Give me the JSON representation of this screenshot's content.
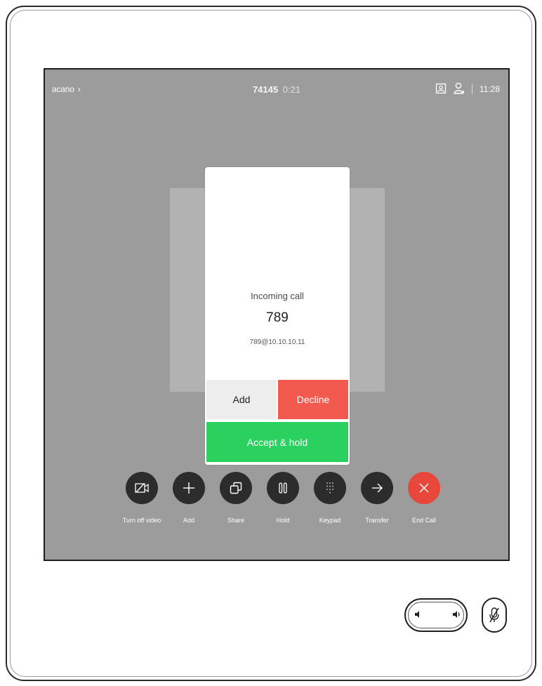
{
  "status_bar": {
    "left_label": "acano",
    "call_number": "74145",
    "call_duration": "0:21",
    "time": "11:28"
  },
  "incoming_call": {
    "title": "Incoming call",
    "number": "789",
    "uri": "789@10.10.10.11",
    "add_label": "Add",
    "decline_label": "Decline",
    "accept_label": "Accept & hold"
  },
  "controls": {
    "turn_off_video": "Turn off video",
    "add": "Add",
    "share": "Share",
    "hold": "Hold",
    "keypad": "Keypad",
    "transfer": "Transfer",
    "end_call": "End Call"
  },
  "colors": {
    "screen_bg": "#9c9c9c",
    "decline": "#f25a4f",
    "accept": "#2bd15f",
    "end_call": "#e8473c",
    "control_button": "#2c2c2c"
  },
  "icons": {
    "turn_off_video": "camera-off-icon",
    "add": "plus-icon",
    "share": "share-icon",
    "hold": "pause-icon",
    "keypad": "keypad-icon",
    "transfer": "arrow-right-icon",
    "end_call": "close-icon",
    "self_view": "self-view-icon",
    "participants": "person-icon",
    "mute": "mic-mute-icon"
  }
}
